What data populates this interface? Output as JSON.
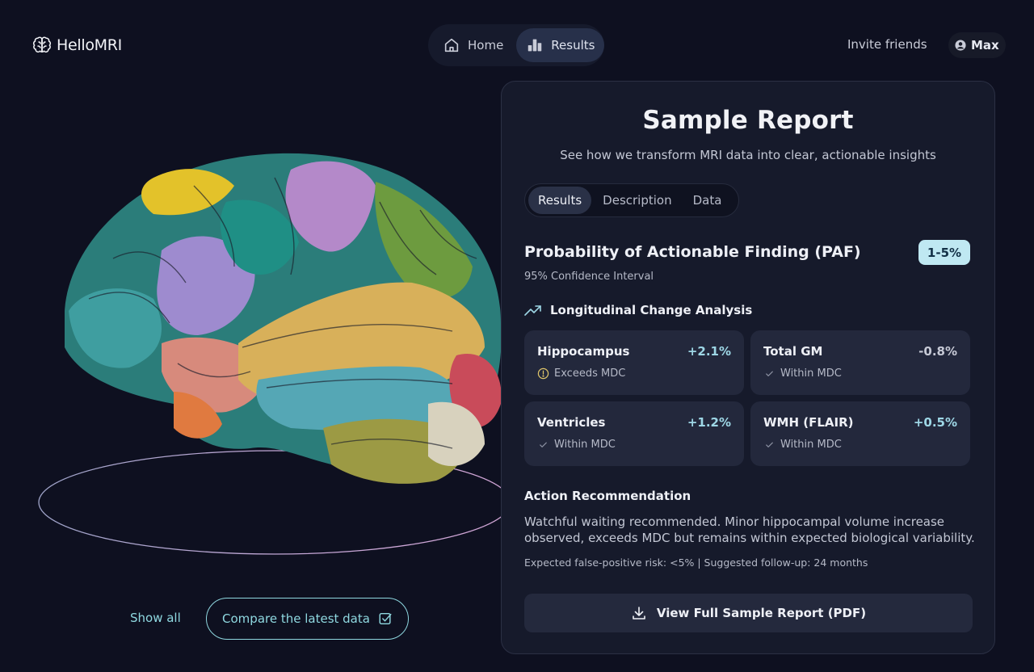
{
  "app": {
    "name": "HelloMRI",
    "logo_icon": "brain-icon"
  },
  "nav": {
    "items": [
      {
        "label": "Home",
        "icon": "home-icon",
        "active": false
      },
      {
        "label": "Results",
        "icon": "bar-chart-icon",
        "active": true
      }
    ]
  },
  "header": {
    "invite_label": "Invite friends",
    "user_name": "Max",
    "user_icon": "user-circle-icon"
  },
  "left_actions": {
    "show_all_label": "Show all",
    "compare_label": "Compare the latest data",
    "compare_icon": "checkbox-icon"
  },
  "report": {
    "title": "Sample Report",
    "subtitle": "See how we transform MRI data into clear, actionable insights",
    "tabs": [
      {
        "label": "Results",
        "active": true
      },
      {
        "label": "Description",
        "active": false
      },
      {
        "label": "Data",
        "active": false
      }
    ],
    "paf": {
      "title": "Probability of Actionable Finding (PAF)",
      "badge": "1-5%",
      "subtitle": "95% Confidence Interval"
    },
    "longitudinal": {
      "heading": "Longitudinal Change Analysis",
      "icon": "trending-up-icon",
      "metrics": [
        {
          "name": "Hippocampus",
          "value": "+2.1%",
          "status": "Exceeds MDC",
          "status_icon": "alert-circle-icon"
        },
        {
          "name": "Total GM",
          "value": "-0.8%",
          "status": "Within MDC",
          "status_icon": "check-icon"
        },
        {
          "name": "Ventricles",
          "value": "+1.2%",
          "status": "Within MDC",
          "status_icon": "check-icon"
        },
        {
          "name": "WMH (FLAIR)",
          "value": "+0.5%",
          "status": "Within MDC",
          "status_icon": "check-icon"
        }
      ]
    },
    "recommendation": {
      "heading": "Action Recommendation",
      "body": "Watchful waiting recommended. Minor hippocampal volume increase observed, exceeds MDC but remains within expected biological variability.",
      "footnote": "Expected false-positive risk: <5% | Suggested follow-up: 24 months"
    },
    "pdf_button": {
      "label": "View Full Sample Report (PDF)",
      "icon": "download-icon"
    }
  },
  "colors": {
    "background": "#0e1020",
    "card": "#161a2b",
    "accent": "#8fd8e0",
    "badge": "#bfe8f2"
  }
}
